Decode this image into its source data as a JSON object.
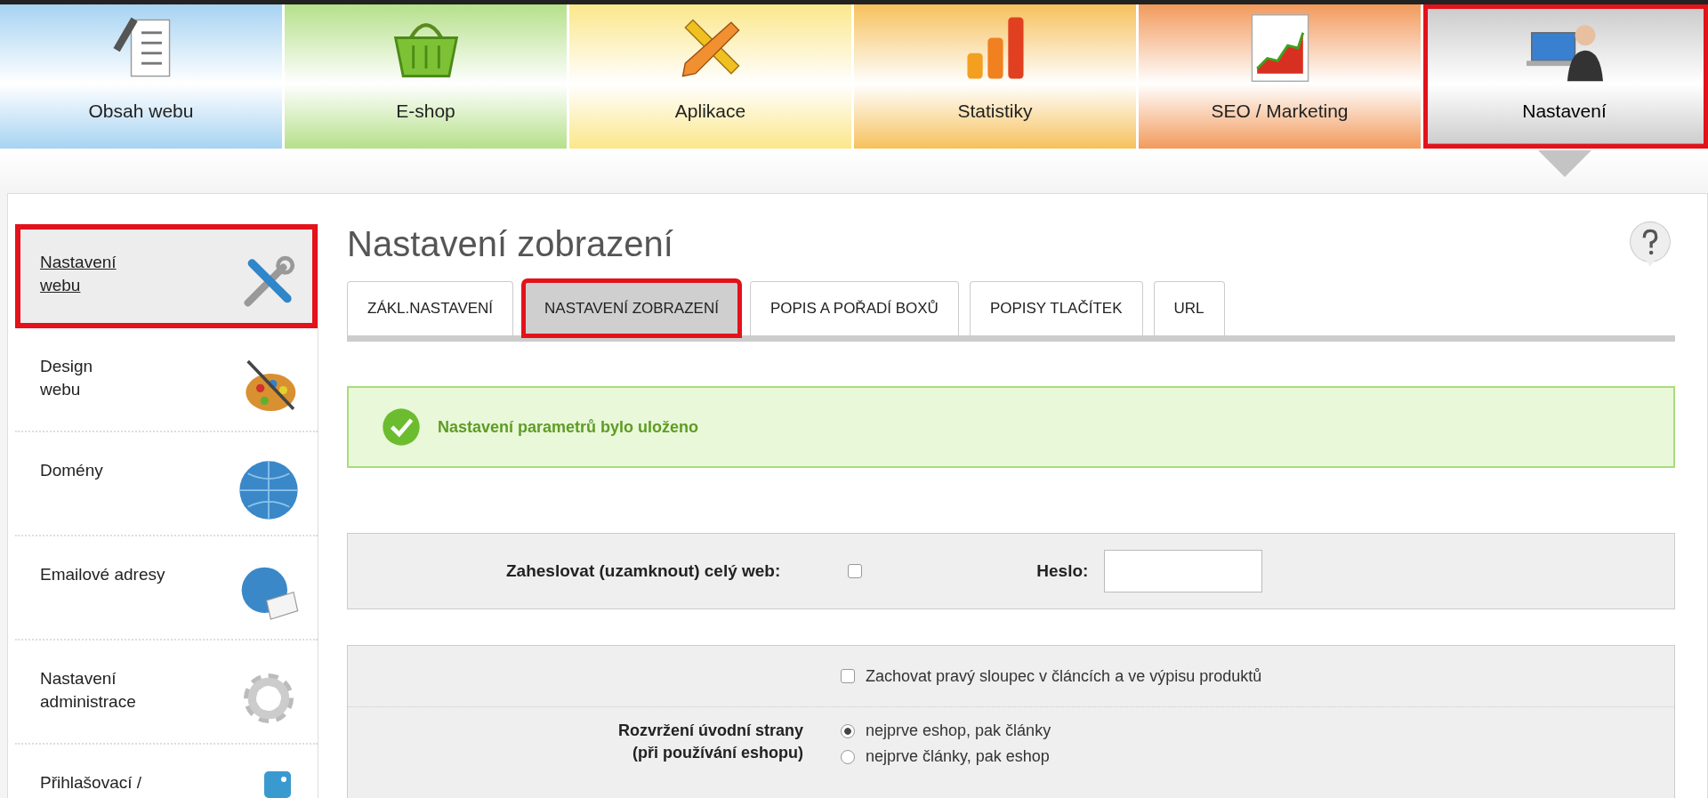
{
  "top_nav": [
    {
      "label": "Obsah webu",
      "color": "#a6d3f2",
      "selected": false,
      "highlighted": false
    },
    {
      "label": "E-shop",
      "color": "#b5e08a",
      "selected": false,
      "highlighted": false
    },
    {
      "label": "Aplikace",
      "color": "#fbe78a",
      "selected": false,
      "highlighted": false
    },
    {
      "label": "Statistiky",
      "color": "#f6c15c",
      "selected": false,
      "highlighted": false
    },
    {
      "label": "SEO / Marketing",
      "color": "#f29a5c",
      "selected": false,
      "highlighted": false
    },
    {
      "label": "Nastavení",
      "color": "#c9c9c9",
      "selected": true,
      "highlighted": true
    }
  ],
  "sidebar": {
    "items": [
      {
        "label": "Nastavení\nwebu",
        "selected": true,
        "highlighted": true
      },
      {
        "label": "Design\nwebu",
        "selected": false,
        "highlighted": false
      },
      {
        "label": "Domény",
        "selected": false,
        "highlighted": false
      },
      {
        "label": "Emailové adresy",
        "selected": false,
        "highlighted": false
      },
      {
        "label": "Nastavení\nadministrace",
        "selected": false,
        "highlighted": false
      },
      {
        "label": "Přihlašovací /",
        "selected": false,
        "highlighted": false
      }
    ]
  },
  "page": {
    "title": "Nastavení zobrazení"
  },
  "tabs": [
    {
      "label": "ZÁKL.NASTAVENÍ",
      "selected": false,
      "highlighted": false
    },
    {
      "label": "NASTAVENÍ ZOBRAZENÍ",
      "selected": true,
      "highlighted": true
    },
    {
      "label": "POPIS A POŘADÍ BOXŮ",
      "selected": false,
      "highlighted": false
    },
    {
      "label": "POPISY TLAČÍTEK",
      "selected": false,
      "highlighted": false
    },
    {
      "label": "URL",
      "selected": false,
      "highlighted": false
    }
  ],
  "alert": {
    "message": "Nastavení parametrů bylo uloženo"
  },
  "lock_section": {
    "label": "Zaheslovat (uzamknout) celý web:",
    "checked": false,
    "password_label": "Heslo:"
  },
  "layout_section": {
    "keep_column": {
      "label": "Zachovat pravý sloupec v článcích a ve výpisu produktů",
      "checked": false
    },
    "homepage_layout": {
      "label": "Rozvržení úvodní strany\n(při používání eshopu)",
      "options": [
        {
          "label": "nejprve eshop, pak články",
          "selected": true
        },
        {
          "label": "nejprve články, pak eshop",
          "selected": false
        }
      ]
    }
  }
}
